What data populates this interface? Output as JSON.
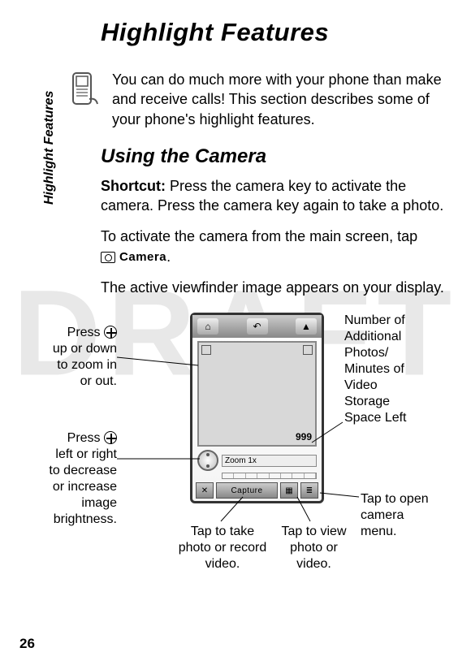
{
  "watermark": "DRAFT",
  "pageTitle": "Highlight Features",
  "sideTab": "Highlight Features",
  "intro": "You can do much more with your phone than make and receive calls! This section describes some of your phone's highlight features.",
  "section": "Using the Camera",
  "shortcutLabel": "Shortcut:",
  "shortcutText": "Press the camera key to activate the camera. Press the camera key again to take a photo.",
  "activateText1": "To activate the camera from the main screen, tap ",
  "activateCamLabel": "Camera",
  "activateText2": ".",
  "viewfinderText": "The active viewfinder image appears on your display.",
  "callouts": {
    "zoom": "Press ⊕ up or down to zoom in or out.",
    "bright": "Press ⊕ left or right to decrease or increase image brightness.",
    "storage": "Number of Additional Photos/ Minutes of Video Storage Space Left",
    "capture": "Tap to take photo or record video.",
    "view": "Tap to view photo or video.",
    "menu": "Tap to open camera menu."
  },
  "phoneUI": {
    "zoomLabel": "Zoom 1x",
    "counter": "999",
    "captureBtn": "Capture",
    "closeGlyph": "✕",
    "storageGlyph": "▦",
    "menuGlyph": "≣",
    "homeGlyph": "⌂",
    "backGlyph": "↶",
    "upGlyph": "▲"
  },
  "pageNum": "26"
}
